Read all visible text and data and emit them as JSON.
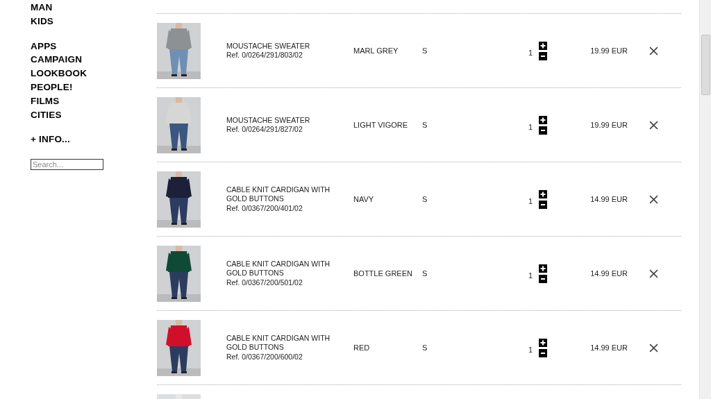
{
  "nav": {
    "groups": [
      [
        "MAN",
        "KIDS"
      ],
      [
        "APPS",
        "CAMPAIGN",
        "LOOKBOOK",
        "PEOPLE!",
        "FILMS",
        "CITIES"
      ],
      [
        "+ INFO..."
      ]
    ]
  },
  "search": {
    "placeholder": "Search..."
  },
  "cart": {
    "rows": [
      {
        "description": "MOUSTACHE SWEATER",
        "ref": "Ref. 0/0264/291/803/02",
        "colour": "MARL GREY",
        "size": "S",
        "quantity": "1",
        "amount": "19.99 EUR"
      },
      {
        "description": "MOUSTACHE SWEATER",
        "ref": "Ref. 0/0264/291/827/02",
        "colour": "LIGHT VIGORE",
        "size": "S",
        "quantity": "1",
        "amount": "19.99 EUR"
      },
      {
        "description": "CABLE KNIT CARDIGAN WITH GOLD BUTTONS",
        "ref": "Ref. 0/0367/200/401/02",
        "colour": "NAVY",
        "size": "S",
        "quantity": "1",
        "amount": "14.99 EUR"
      },
      {
        "description": "CABLE KNIT CARDIGAN WITH GOLD BUTTONS",
        "ref": "Ref. 0/0367/200/501/02",
        "colour": "BOTTLE GREEN",
        "size": "S",
        "quantity": "1",
        "amount": "14.99 EUR"
      },
      {
        "description": "CABLE KNIT CARDIGAN WITH GOLD BUTTONS",
        "ref": "Ref. 0/0367/200/600/02",
        "colour": "RED",
        "size": "S",
        "quantity": "1",
        "amount": "14.99 EUR"
      }
    ]
  }
}
